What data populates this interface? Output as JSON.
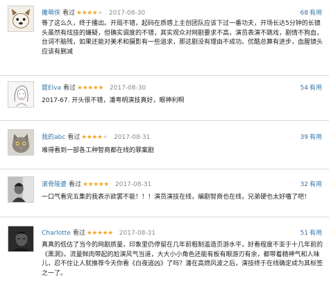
{
  "reviews": [
    {
      "user": "撇萌侠",
      "watched": "看过",
      "rating": 4,
      "date": "2017-08-30",
      "useful_count": "68",
      "useful_label": "有用",
      "text": "等了这么久，终于播出。开局不错，起码在质感上主创团队应该下过一番功夫，开场长达5分钟的长镜头虽然有炫技的嫌疑，但确实调度的不错，其实观众对网剧要求不高，演员表演不跳戏，剧情不狗血，台词不脑残，如果还能对美术和摄影有一些追求，那这剧没有理由不成功。优酷总算有进步，血腥镜头应该有删减",
      "avatar": "dog-avatar"
    },
    {
      "user": "筵Elva",
      "watched": "看过",
      "rating": 5,
      "date": "2017-08-30",
      "useful_count": "54",
      "useful_label": "有用",
      "text": "2017-67. 开头很不错，潘粤明演技真好，眼神利啊",
      "avatar": "sketch-avatar"
    },
    {
      "user": "我的abc",
      "watched": "看过",
      "rating": 4,
      "date": "2017-08-31",
      "useful_count": "39",
      "useful_label": "有用",
      "text": "难得看到一部各工种智商都在线的罪案剧",
      "avatar": "cat-avatar"
    },
    {
      "user": "滚骨陵婆",
      "watched": "看过",
      "rating": 5,
      "date": "2017-08-31",
      "useful_count": "32",
      "useful_label": "有用",
      "text": "一口气看完五集的我表示欲罢不能！！！演员演技在线，编剧智商也在线，兄弟硬也太好嗑了吧！",
      "avatar": "portrait-avatar"
    },
    {
      "user": "Charlotte",
      "watched": "看过",
      "rating": 5,
      "date": "2017-08-31",
      "useful_count": "51",
      "useful_label": "有用",
      "text": "真真的低估了当今的网剧质量，印象里仍停留在几年前粗制滥造页游水平，好看程度不亚于十几年前的《黑洞》。流量鲜肉带起的尬演风气当道，大大小小角色还能有板有眼游刃有余，都带着精神气和人味儿，忍不住让人就推荐今天你看《白夜追凶》了吗？潘在高燃风波之后，演技终于在线确定成为其标签之一了。",
      "avatar": "dark-portrait-avatar"
    }
  ],
  "colors": {
    "username": "#3377aa",
    "star_on": "#f4a826",
    "star_off": "#d9d9d9",
    "date": "#888888",
    "divider": "#d8d8d8"
  }
}
